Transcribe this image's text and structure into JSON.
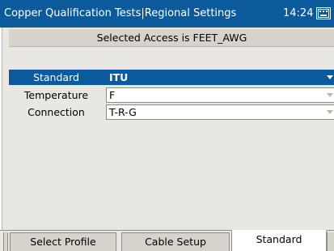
{
  "titlebar": {
    "title": "Copper Qualification Tests|Regional Settings",
    "clock": "14:24",
    "keyboard_icon": "keyboard-icon"
  },
  "status": {
    "text": "Selected Access  is FEET_AWG"
  },
  "rows": [
    {
      "label": "Standard",
      "value": "ITU",
      "selected": true
    },
    {
      "label": "Temperature",
      "value": "F",
      "selected": false
    },
    {
      "label": "Connection",
      "value": "T-R-G",
      "selected": false
    }
  ],
  "tabs": [
    {
      "label": "Select Profile"
    },
    {
      "label": "Cable Setup"
    },
    {
      "label": "Standard",
      "active": true
    }
  ],
  "colors": {
    "accent": "#0a5a9c",
    "panel": "#e9e7e2"
  }
}
